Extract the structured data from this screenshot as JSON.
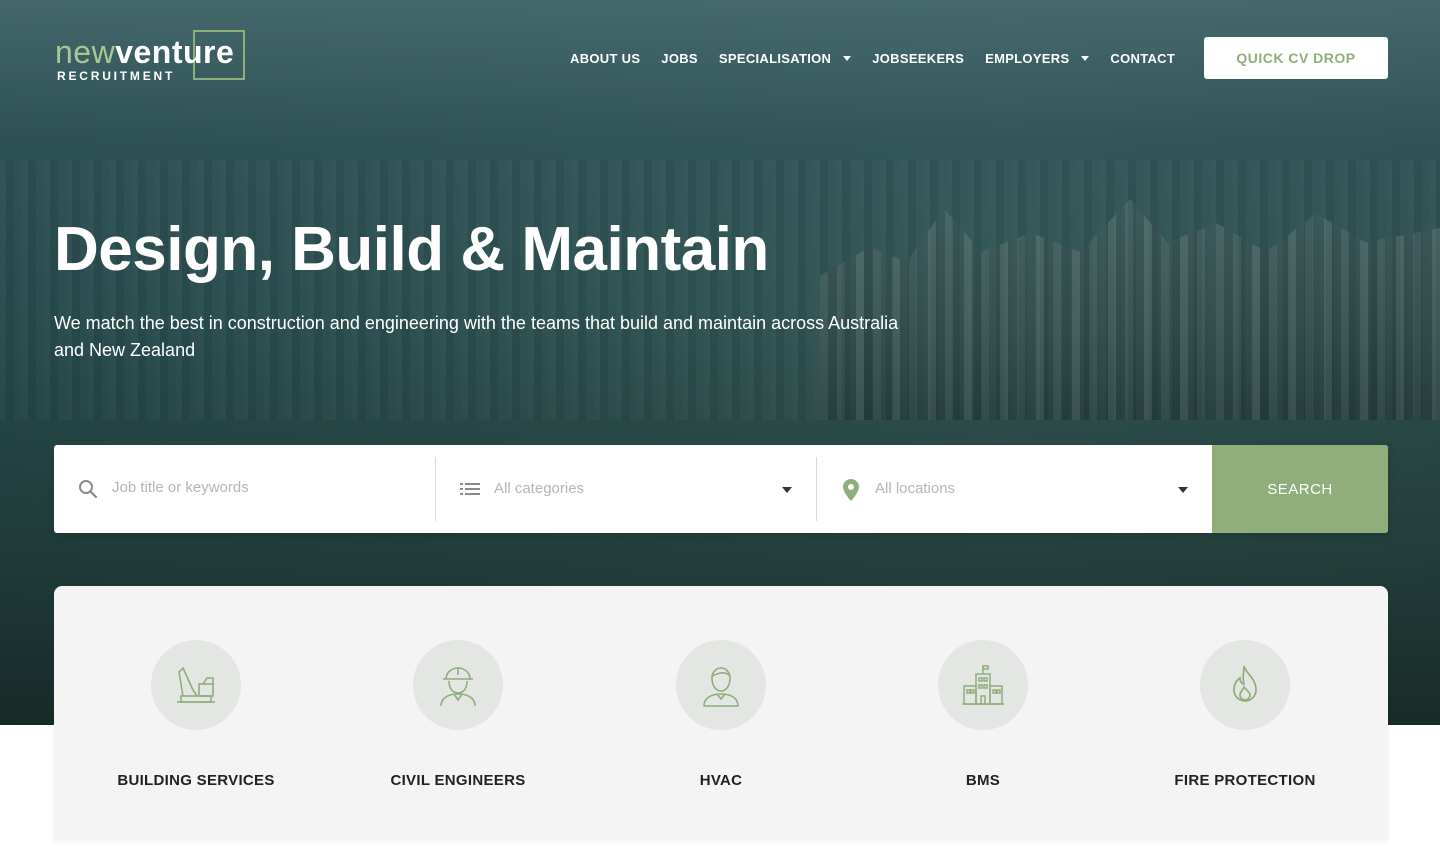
{
  "brand": {
    "logo_new": "new",
    "logo_venture": "venture",
    "logo_sub": "RECRUITMENT",
    "accent_color": "#8fae7c"
  },
  "nav": {
    "items": [
      {
        "label": "ABOUT US",
        "dropdown": false
      },
      {
        "label": "JOBS",
        "dropdown": false
      },
      {
        "label": "SPECIALISATION",
        "dropdown": true
      },
      {
        "label": "JOBSEEKERS",
        "dropdown": false
      },
      {
        "label": "EMPLOYERS",
        "dropdown": true
      },
      {
        "label": "CONTACT",
        "dropdown": false
      }
    ],
    "cta_label": "QUICK CV DROP"
  },
  "hero": {
    "title": "Design, Build & Maintain",
    "subtitle": "We match the best in construction and engineering with the teams that build and maintain across Australia and New Zealand"
  },
  "search": {
    "keywords_placeholder": "Job title or keywords",
    "category_placeholder": "All categories",
    "location_placeholder": "All locations",
    "button_label": "SEARCH",
    "icons": [
      "search-icon",
      "list-icon",
      "map-pin-icon"
    ]
  },
  "categories": {
    "items": [
      {
        "label": "BUILDING SERVICES",
        "icon": "crane-icon"
      },
      {
        "label": "CIVIL ENGINEERS",
        "icon": "hard-hat-worker-icon"
      },
      {
        "label": "HVAC",
        "icon": "person-icon"
      },
      {
        "label": "BMS",
        "icon": "buildings-icon"
      },
      {
        "label": "FIRE PROTECTION",
        "icon": "flame-icon"
      }
    ]
  }
}
